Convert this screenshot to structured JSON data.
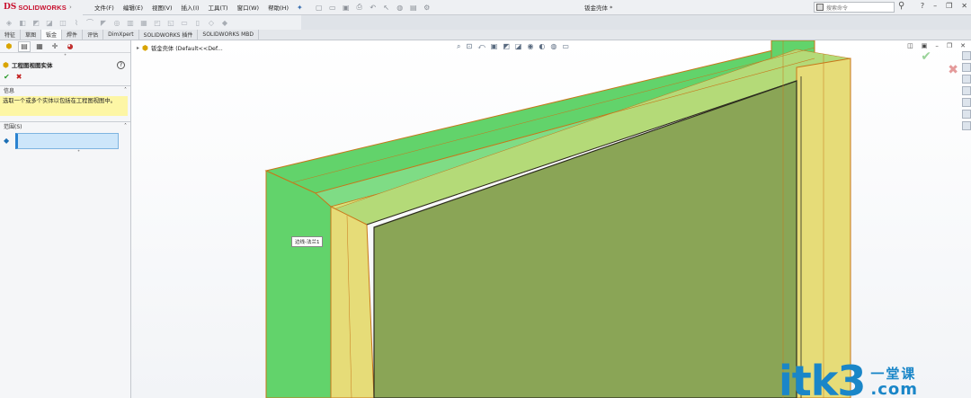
{
  "app": {
    "logo_prefix": "DS",
    "logo_text": "SOLIDWORKS",
    "document_title": "钣金壳体 *"
  },
  "menu": [
    {
      "id": "file",
      "label": "文件(F)"
    },
    {
      "id": "edit",
      "label": "编辑(E)"
    },
    {
      "id": "view",
      "label": "视图(V)"
    },
    {
      "id": "insert",
      "label": "插入(I)"
    },
    {
      "id": "tools",
      "label": "工具(T)"
    },
    {
      "id": "window",
      "label": "窗口(W)"
    },
    {
      "id": "help",
      "label": "帮助(H)"
    }
  ],
  "search": {
    "placeholder": "搜索命令"
  },
  "tabs": [
    {
      "label": "特征"
    },
    {
      "label": "草图"
    },
    {
      "label": "钣金"
    },
    {
      "label": "焊件"
    },
    {
      "label": "评估"
    },
    {
      "label": "DimXpert"
    },
    {
      "label": "SOLIDWORKS 插件"
    },
    {
      "label": "SOLIDWORKS MBD"
    }
  ],
  "active_tab_index": 2,
  "property_manager": {
    "title": "工程图视图实体",
    "info_section": "信息",
    "info_text": "选取一个或多个实体以包括在工程图视图中。",
    "scope_section": "范围(S)"
  },
  "feature_tree": {
    "root_label": "钣金壳体 (Default<<Def..."
  },
  "tooltip": {
    "text": "边线-法兰1"
  },
  "watermark": {
    "main": "itk3",
    "cn": "一堂课",
    "suffix": ".com"
  },
  "colors": {
    "green_face": "#62d36b",
    "yellow_face": "#e6dc78",
    "inner_face": "#8aa556",
    "edge_orange": "#c8761a",
    "selection_blue": "#cde6fa",
    "info_yellow": "#fdf6a5",
    "brand_red": "#c8102e",
    "watermark_blue": "#1a86c8"
  }
}
